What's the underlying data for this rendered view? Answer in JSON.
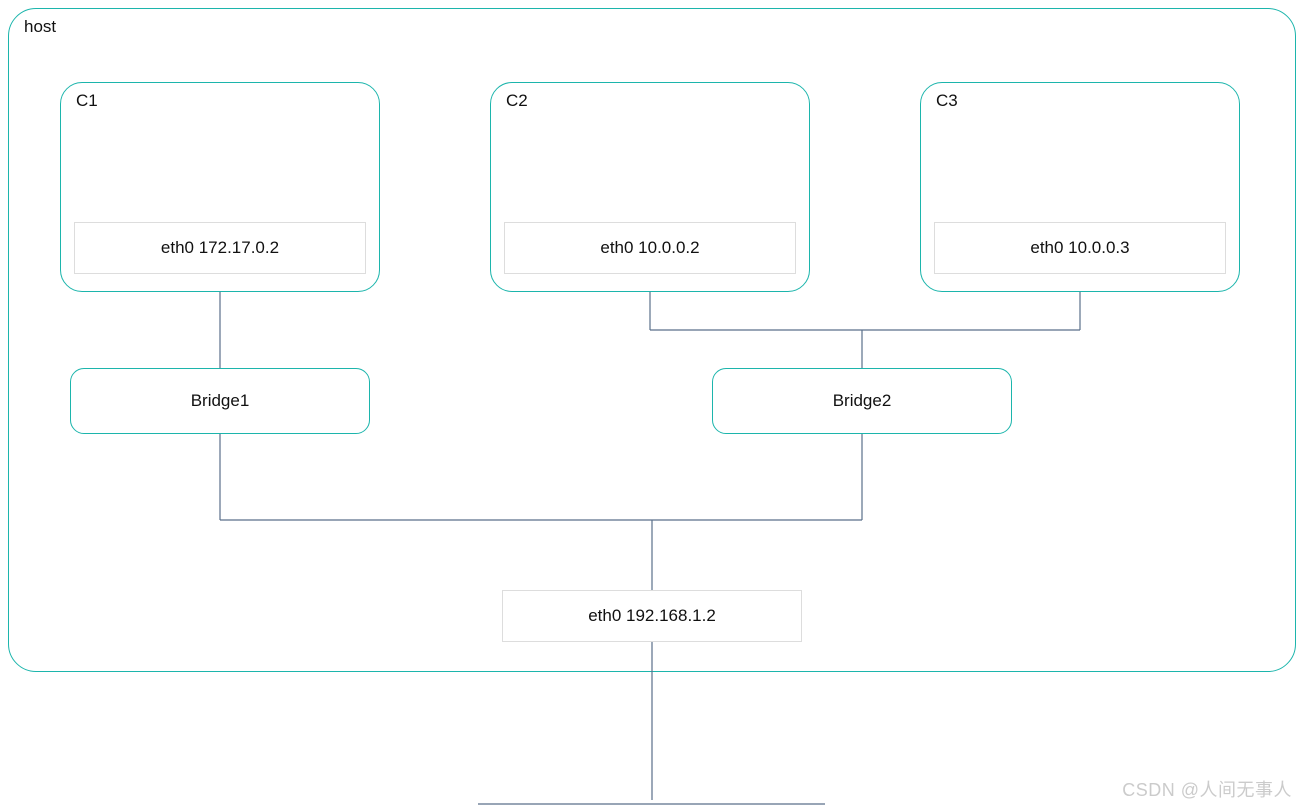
{
  "host": {
    "label": "host"
  },
  "containers": {
    "c1": {
      "label": "C1",
      "eth": "eth0 172.17.0.2"
    },
    "c2": {
      "label": "C2",
      "eth": "eth0 10.0.0.2"
    },
    "c3": {
      "label": "C3",
      "eth": "eth0 10.0.0.3"
    }
  },
  "bridges": {
    "b1": {
      "label": "Bridge1"
    },
    "b2": {
      "label": "Bridge2"
    }
  },
  "host_eth": {
    "label": "eth0 192.168.1.2"
  },
  "watermark": "CSDN @人间无事人"
}
